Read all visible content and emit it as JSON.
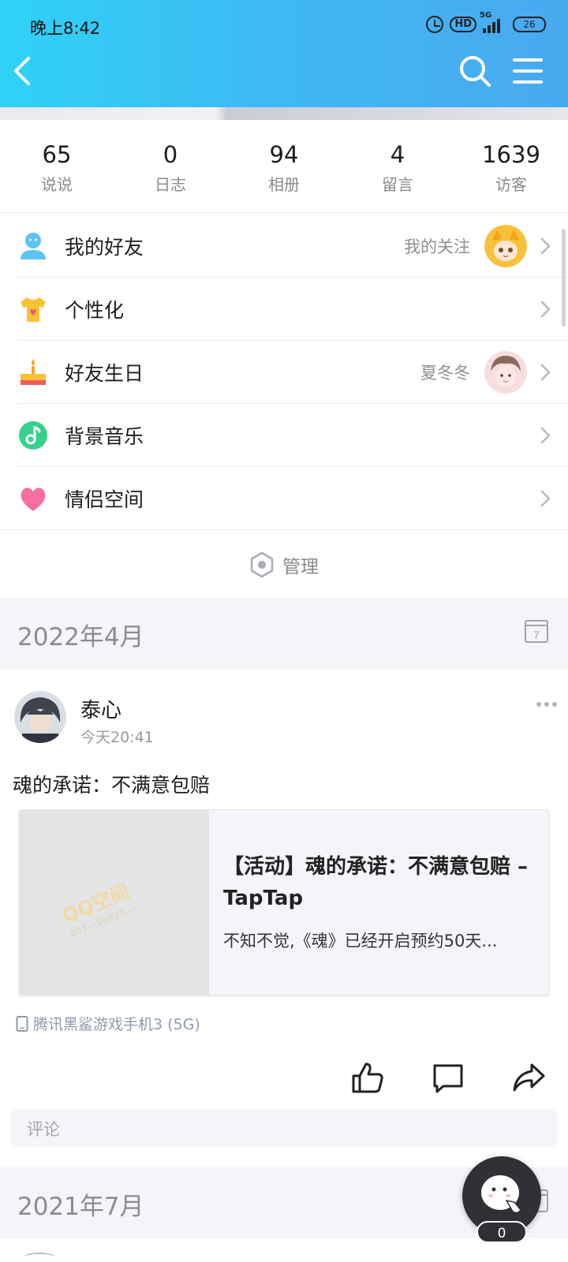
{
  "status_bar": {
    "time": "晚上8:42",
    "hd": "HD",
    "network": "5G",
    "battery": "26"
  },
  "stats": [
    {
      "count": "65",
      "label": "说说"
    },
    {
      "count": "0",
      "label": "日志"
    },
    {
      "count": "94",
      "label": "相册"
    },
    {
      "count": "4",
      "label": "留言"
    },
    {
      "count": "1639",
      "label": "访客"
    }
  ],
  "menu": [
    {
      "icon": "person-icon",
      "label": "我的好友",
      "right_text": "我的关注",
      "has_avatar": true
    },
    {
      "icon": "tshirt-icon",
      "label": "个性化",
      "right_text": ""
    },
    {
      "icon": "cake-icon",
      "label": "好友生日",
      "right_text": "夏冬冬",
      "has_avatar": true
    },
    {
      "icon": "music-note-icon",
      "label": "背景音乐",
      "right_text": ""
    },
    {
      "icon": "heart-icon",
      "label": "情侣空间",
      "right_text": ""
    }
  ],
  "manage": {
    "label": "管理"
  },
  "sections": [
    {
      "date": "2022年4月",
      "calendar_day": "7"
    },
    {
      "date": "2021年7月"
    }
  ],
  "post": {
    "author": "泰心",
    "time": "今天20:41",
    "text": "魂的承诺：不满意包赔",
    "share": {
      "title": "【活动】魂的承诺：不满意包赔 – TapTap",
      "description": "不知不觉,《魂》已经开启预约50天...",
      "watermark_logo": "QQ空间",
      "watermark_id": "403---99997----"
    },
    "device": "腾讯黑鲨游戏手机3 (5G)",
    "comment_placeholder": "评论"
  },
  "fab": {
    "count": "0"
  },
  "colors": {
    "header_start": "#2fd2f7",
    "header_end": "#49a9ef",
    "band": "#f3f5f9"
  }
}
